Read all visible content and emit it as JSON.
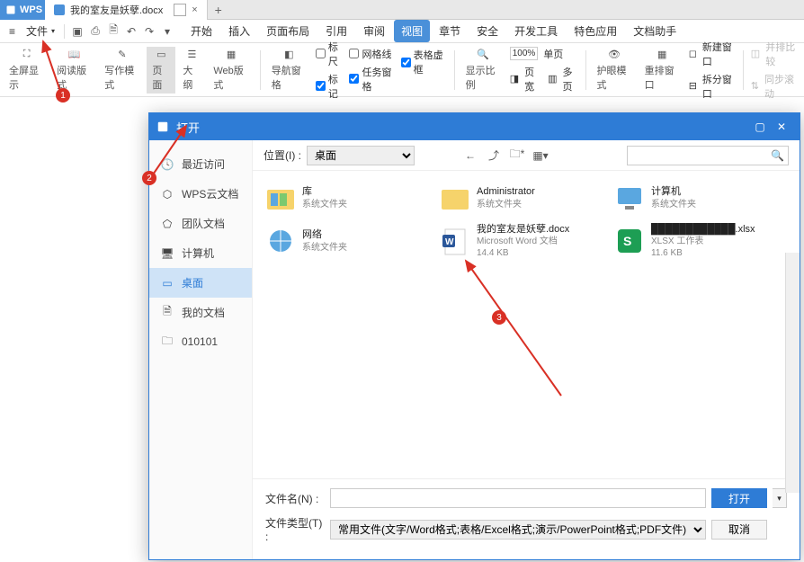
{
  "titlebar": {
    "app": "WPS",
    "tab_name": "我的室友是妖孽.docx",
    "tab_close": "×",
    "new_tab": "+"
  },
  "menubar": {
    "file": "文件",
    "tabs": [
      "开始",
      "插入",
      "页面布局",
      "引用",
      "审阅",
      "视图",
      "章节",
      "安全",
      "开发工具",
      "特色应用",
      "文档助手"
    ],
    "active_index": 5
  },
  "ribbon": {
    "fullscreen": "全屏显示",
    "readmode": "阅读版式",
    "writemode": "写作模式",
    "page": "页面",
    "outline": "大纲",
    "web": "Web版式",
    "navpane": "导航窗格",
    "ruler": "标尺",
    "grid": "网格线",
    "tablevirt": "表格虚框",
    "marker": "标记",
    "taskpane": "任务窗格",
    "zoom": "显示比例",
    "pct": "100%",
    "pagewidth": "页宽",
    "multipage": "多页",
    "singlepage": "单页",
    "eyecare": "护眼模式",
    "resetwin": "重排窗口",
    "newwin": "新建窗口",
    "splitwin": "拆分窗口",
    "compare": "并排比较",
    "syncscroll": "同步滚动"
  },
  "dialog": {
    "title": "打开",
    "sidebar": [
      {
        "icon": "clock",
        "label": "最近访问"
      },
      {
        "icon": "cloud",
        "label": "WPS云文档"
      },
      {
        "icon": "team",
        "label": "团队文档"
      },
      {
        "icon": "pc",
        "label": "计算机"
      },
      {
        "icon": "desktop",
        "label": "桌面"
      },
      {
        "icon": "docs",
        "label": "我的文档"
      },
      {
        "icon": "folder",
        "label": "010101"
      }
    ],
    "active_side": 4,
    "location_label": "位置(I) :",
    "location_value": "桌面",
    "files": [
      {
        "icon": "folder-lib",
        "name": "库",
        "meta": "系统文件夹"
      },
      {
        "icon": "folder-user",
        "name": "Administrator",
        "meta": "系统文件夹"
      },
      {
        "icon": "computer",
        "name": "计算机",
        "meta": "系统文件夹"
      },
      {
        "icon": "network",
        "name": "网络",
        "meta": "系统文件夹"
      },
      {
        "icon": "word",
        "name": "我的室友是妖孽.docx",
        "meta": "Microsoft Word 文档",
        "meta2": "14.4 KB"
      },
      {
        "icon": "xlsx",
        "name": "████████████.xlsx",
        "meta": "XLSX 工作表",
        "meta2": "11.6 KB"
      }
    ],
    "footer": {
      "filename_label": "文件名(N) :",
      "filename_value": "",
      "filetype_label": "文件类型(T) :",
      "filetype_value": "常用文件(文字/Word格式;表格/Excel格式;演示/PowerPoint格式;PDF文件)",
      "open_btn": "打开",
      "cancel_btn": "取消"
    }
  },
  "annotations": {
    "a1": "1",
    "a2": "2",
    "a3": "3"
  }
}
